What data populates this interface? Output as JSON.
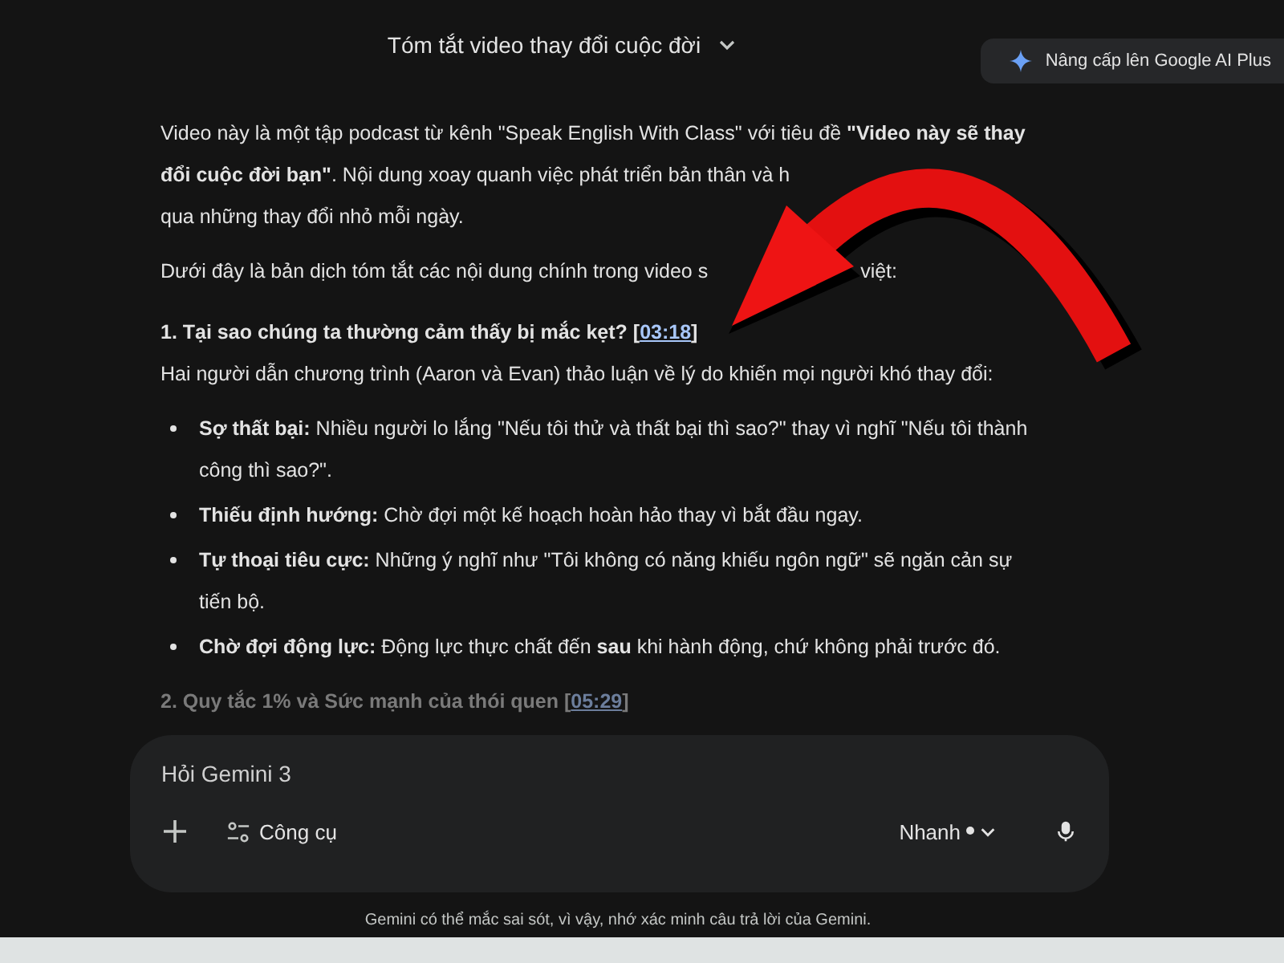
{
  "header": {
    "title": "Tóm tắt video thay đổi cuộc đời",
    "upgrade_button": "Nâng cấp lên Google AI Plus"
  },
  "intro": {
    "text_before_arrow": "Video này là một tập podcast từ kênh \"Speak English With Class\" với tiêu đề **\"Video này sẽ thay đổi cuộc đời bạn\"**. Nội dung xoay quanh việc phát triển bản thân và h",
    "text_after_arrow": "qua những thay đổi nhỏ mỗi ngày."
  },
  "lead": {
    "text_before_arrow": "Dưới đây là bản dịch tóm tắt các nội dung chính trong video s",
    "text_after_arrow": "việt:"
  },
  "sections": [
    {
      "heading": "1. Tại sao chúng ta thường cảm thấy bị mắc kẹt? [",
      "timestamp": "03:18",
      "heading_end": "]",
      "dimmed": false,
      "intro": "Hai người dẫn chương trình (Aaron và Evan) thảo luận về lý do khiến mọi người khó thay đổi:",
      "bullets": [
        "**Sợ thất bại:** Nhiều người lo lắng \"Nếu tôi thử và thất bại thì sao?\" thay vì nghĩ \"Nếu tôi thành công thì sao?\".",
        "**Thiếu định hướng:** Chờ đợi một kế hoạch hoàn hảo thay vì bắt đầu ngay.",
        "**Tự thoại tiêu cực:** Những ý nghĩ như \"Tôi không có năng khiếu ngôn ngữ\" sẽ ngăn cản sự tiến bộ.",
        "**Chờ đợi động lực:** Động lực thực chất đến **sau** khi hành động, chứ không phải trước đó."
      ]
    },
    {
      "heading": "2. Quy tắc 1% và Sức mạnh của thói quen [",
      "timestamp": "05:29",
      "heading_end": "]",
      "dimmed": true
    }
  ],
  "composer": {
    "placeholder": "Hỏi Gemini 3",
    "tools_button": "Công cụ",
    "mode_button": "Nhanh"
  },
  "disclaimer": "Gemini có thể mắc sai sót, vì vậy, nhớ xác minh câu trả lời của Gemini."
}
